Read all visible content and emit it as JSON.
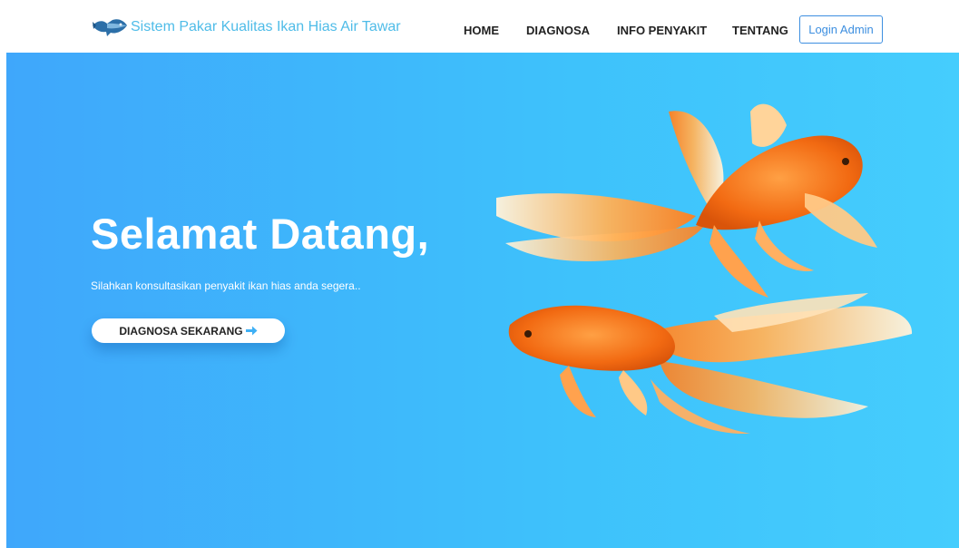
{
  "navbar": {
    "brand_text": "Sistem Pakar Kualitas Ikan Hias Air Tawar",
    "brand_icon": "fish-logo-icon",
    "items": [
      {
        "label": "HOME"
      },
      {
        "label": "DIAGNOSA"
      },
      {
        "label": "INFO PENYAKIT"
      },
      {
        "label": "TENTANG"
      }
    ],
    "login_label": "Login Admin"
  },
  "hero": {
    "title": "Selamat Datang,",
    "subtitle": "Silahkan konsultasikan penyakit ikan hias anda segera..",
    "cta_label": "DIAGNOSA SEKARANG",
    "cta_icon": "arrow-right-icon",
    "image": "goldfish-illustration"
  },
  "colors": {
    "brand_text": "#4fbce8",
    "login_border": "#3d8fe0",
    "hero_gradient_start": "#3fa7fb",
    "hero_gradient_end": "#45cdfd",
    "cta_arrow": "#3fb0f5"
  }
}
